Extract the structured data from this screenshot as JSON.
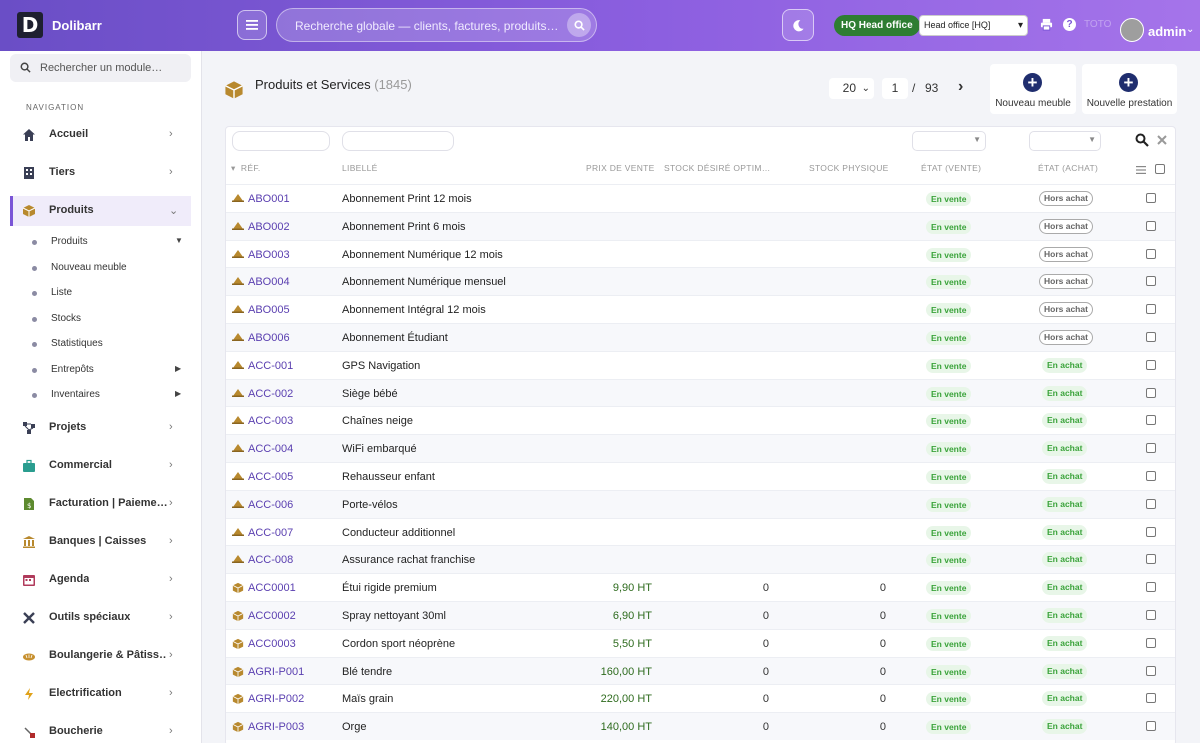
{
  "app": {
    "brand": "Dolibarr",
    "logo_letter": "D"
  },
  "topbar": {
    "search_placeholder": "Recherche globale — clients, factures, produits…",
    "hq_badge": "HQ Head office",
    "entity": "Head office [HQ]",
    "faded_label": "TOTO",
    "user": "admin"
  },
  "sidebar": {
    "search_placeholder": "Rechercher un module…",
    "heading": "NAVIGATION",
    "items": [
      {
        "label": "Accueil",
        "icon": "home-icon"
      },
      {
        "label": "Tiers",
        "icon": "building-icon"
      },
      {
        "label": "Produits",
        "icon": "box-icon"
      },
      {
        "label": "Projets",
        "icon": "project-icon"
      },
      {
        "label": "Commercial",
        "icon": "briefcase-icon"
      },
      {
        "label": "Facturation | Paieme…",
        "icon": "invoice-icon"
      },
      {
        "label": "Banques | Caisses",
        "icon": "bank-icon"
      },
      {
        "label": "Agenda",
        "icon": "calendar-icon"
      },
      {
        "label": "Outils spéciaux",
        "icon": "tools-icon"
      },
      {
        "label": "Boulangerie & Pâtiss…",
        "icon": "bakery-icon"
      },
      {
        "label": "Electrification",
        "icon": "bolt-icon"
      },
      {
        "label": "Boucherie",
        "icon": "butcher-icon"
      }
    ],
    "sub_items": [
      "Produits",
      "Nouveau meuble",
      "Liste",
      "Stocks",
      "Statistiques",
      "Entrepôts",
      "Inventaires"
    ]
  },
  "main": {
    "title": "Produits et Services",
    "count": "(1845)",
    "per_page": "20",
    "page": "1",
    "sep": "/",
    "total_pages": "93",
    "btn_new_furniture": "Nouveau meuble",
    "btn_new_service": "Nouvelle prestation"
  },
  "table": {
    "headers": [
      "RÉF.",
      "LIBELLÉ",
      "PRIX DE VENTE",
      "STOCK DÉSIRÉ OPTIM…",
      "STOCK PHYSIQUE",
      "ÉTAT (VENTE)",
      "ÉTAT (ACHAT)"
    ],
    "rows": [
      {
        "ref": "ABO001",
        "label": "Abonnement Print 12 mois",
        "price": "",
        "stock_opt": "",
        "stock_phys": "",
        "sale": "En vente",
        "buy": "Hors achat",
        "buy_on": false,
        "type": "service"
      },
      {
        "ref": "ABO002",
        "label": "Abonnement Print 6 mois",
        "price": "",
        "stock_opt": "",
        "stock_phys": "",
        "sale": "En vente",
        "buy": "Hors achat",
        "buy_on": false,
        "type": "service"
      },
      {
        "ref": "ABO003",
        "label": "Abonnement Numérique 12 mois",
        "price": "",
        "stock_opt": "",
        "stock_phys": "",
        "sale": "En vente",
        "buy": "Hors achat",
        "buy_on": false,
        "type": "service"
      },
      {
        "ref": "ABO004",
        "label": "Abonnement Numérique mensuel",
        "price": "",
        "stock_opt": "",
        "stock_phys": "",
        "sale": "En vente",
        "buy": "Hors achat",
        "buy_on": false,
        "type": "service"
      },
      {
        "ref": "ABO005",
        "label": "Abonnement Intégral 12 mois",
        "price": "",
        "stock_opt": "",
        "stock_phys": "",
        "sale": "En vente",
        "buy": "Hors achat",
        "buy_on": false,
        "type": "service"
      },
      {
        "ref": "ABO006",
        "label": "Abonnement Étudiant",
        "price": "",
        "stock_opt": "",
        "stock_phys": "",
        "sale": "En vente",
        "buy": "Hors achat",
        "buy_on": false,
        "type": "service"
      },
      {
        "ref": "ACC-001",
        "label": "GPS Navigation",
        "price": "",
        "stock_opt": "",
        "stock_phys": "",
        "sale": "En vente",
        "buy": "En achat",
        "buy_on": true,
        "type": "service"
      },
      {
        "ref": "ACC-002",
        "label": "Siège bébé",
        "price": "",
        "stock_opt": "",
        "stock_phys": "",
        "sale": "En vente",
        "buy": "En achat",
        "buy_on": true,
        "type": "service"
      },
      {
        "ref": "ACC-003",
        "label": "Chaînes neige",
        "price": "",
        "stock_opt": "",
        "stock_phys": "",
        "sale": "En vente",
        "buy": "En achat",
        "buy_on": true,
        "type": "service"
      },
      {
        "ref": "ACC-004",
        "label": "WiFi embarqué",
        "price": "",
        "stock_opt": "",
        "stock_phys": "",
        "sale": "En vente",
        "buy": "En achat",
        "buy_on": true,
        "type": "service"
      },
      {
        "ref": "ACC-005",
        "label": "Rehausseur enfant",
        "price": "",
        "stock_opt": "",
        "stock_phys": "",
        "sale": "En vente",
        "buy": "En achat",
        "buy_on": true,
        "type": "service"
      },
      {
        "ref": "ACC-006",
        "label": "Porte-vélos",
        "price": "",
        "stock_opt": "",
        "stock_phys": "",
        "sale": "En vente",
        "buy": "En achat",
        "buy_on": true,
        "type": "service"
      },
      {
        "ref": "ACC-007",
        "label": "Conducteur additionnel",
        "price": "",
        "stock_opt": "",
        "stock_phys": "",
        "sale": "En vente",
        "buy": "En achat",
        "buy_on": true,
        "type": "service"
      },
      {
        "ref": "ACC-008",
        "label": "Assurance rachat franchise",
        "price": "",
        "stock_opt": "",
        "stock_phys": "",
        "sale": "En vente",
        "buy": "En achat",
        "buy_on": true,
        "type": "service"
      },
      {
        "ref": "ACC0001",
        "label": "Étui rigide premium",
        "price": "9,90 HT",
        "stock_opt": "0",
        "stock_phys": "0",
        "sale": "En vente",
        "buy": "En achat",
        "buy_on": true,
        "type": "product"
      },
      {
        "ref": "ACC0002",
        "label": "Spray nettoyant 30ml",
        "price": "6,90 HT",
        "stock_opt": "0",
        "stock_phys": "0",
        "sale": "En vente",
        "buy": "En achat",
        "buy_on": true,
        "type": "product"
      },
      {
        "ref": "ACC0003",
        "label": "Cordon sport néoprène",
        "price": "5,50 HT",
        "stock_opt": "0",
        "stock_phys": "0",
        "sale": "En vente",
        "buy": "En achat",
        "buy_on": true,
        "type": "product"
      },
      {
        "ref": "AGRI-P001",
        "label": "Blé tendre",
        "price": "160,00 HT",
        "stock_opt": "0",
        "stock_phys": "0",
        "sale": "En vente",
        "buy": "En achat",
        "buy_on": true,
        "type": "product"
      },
      {
        "ref": "AGRI-P002",
        "label": "Maïs grain",
        "price": "220,00 HT",
        "stock_opt": "0",
        "stock_phys": "0",
        "sale": "En vente",
        "buy": "En achat",
        "buy_on": true,
        "type": "product"
      },
      {
        "ref": "AGRI-P003",
        "label": "Orge",
        "price": "140,00 HT",
        "stock_opt": "0",
        "stock_phys": "0",
        "sale": "En vente",
        "buy": "En achat",
        "buy_on": true,
        "type": "product"
      }
    ]
  },
  "colors": {
    "accent": "#7a55d6",
    "link": "#5a3fb0",
    "price": "#2e6b1e",
    "badge_green": "#3aa33a"
  }
}
